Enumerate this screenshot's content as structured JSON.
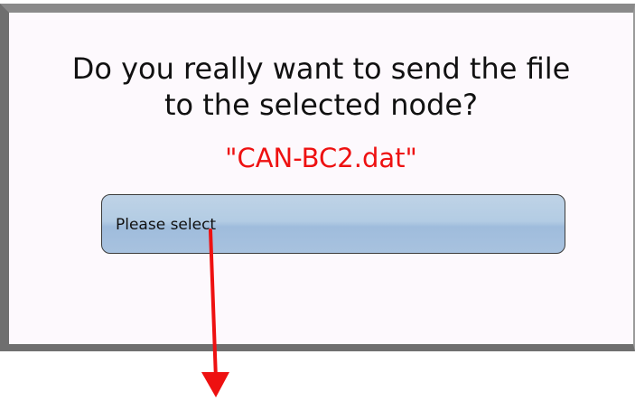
{
  "dialog": {
    "question_line1": "Do you really want to send the file",
    "question_line2": "to the selected node?",
    "filename": "\"CAN-BC2.dat\"",
    "select": {
      "value": "Please select"
    }
  },
  "colors": {
    "filename": "#ee1111",
    "annotation_arrow": "#ee1111",
    "select_fill": "#b3cce4",
    "panel_bg": "#fdf9fd"
  },
  "icons": {
    "annotation": "red-arrow-down-icon"
  }
}
